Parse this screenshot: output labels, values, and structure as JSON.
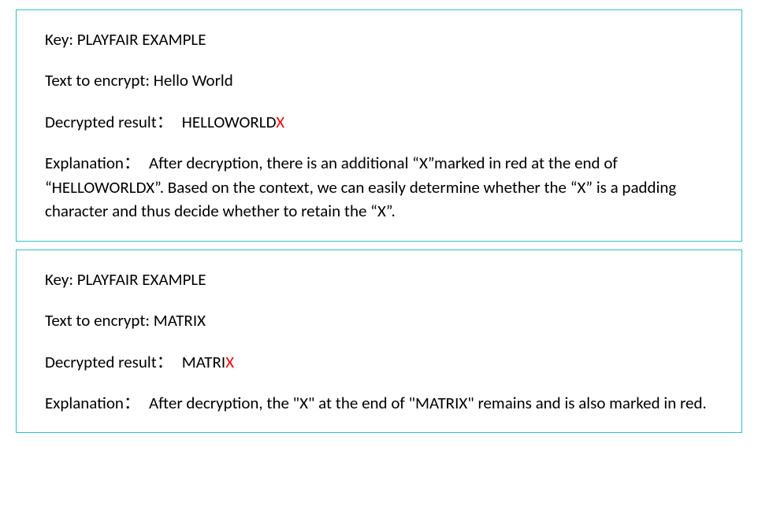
{
  "examples": [
    {
      "key_label": "Key: ",
      "key_value": "PLAYFAIR EXAMPLE",
      "text_label": "Text to encrypt: ",
      "text_value": "Hello World",
      "result_label": "Decrypted result： ",
      "result_value": "HELLOWORLD",
      "result_suffix": "X",
      "explanation_label": "Explanation： ",
      "explanation_text": "After decryption, there is an additional “X”marked in red at the end of “HELLOWORLDX”. Based on the context, we can easily determine whether the “X” is a padding character and thus decide whether to retain the “X”."
    },
    {
      "key_label": "Key: ",
      "key_value": "PLAYFAIR EXAMPLE",
      "text_label": "Text to encrypt: ",
      "text_value": "MATRIX",
      "result_label": "Decrypted result： ",
      "result_value": "MATRI",
      "result_suffix": "X",
      "explanation_label": "Explanation： ",
      "explanation_text": "After decryption, the \"X\" at the end of \"MATRIX\" remains and is also marked in red."
    }
  ]
}
